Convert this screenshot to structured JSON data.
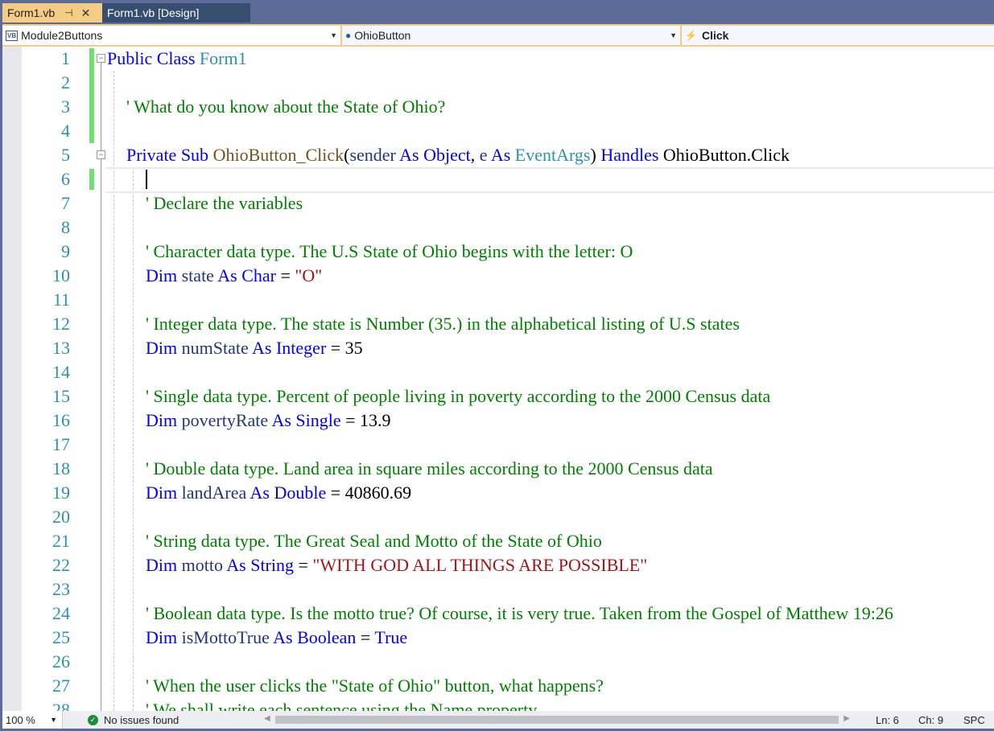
{
  "tabs": [
    {
      "label": "Form1.vb",
      "active": true,
      "pin": "⊣",
      "close": "✕"
    },
    {
      "label": "Form1.vb [Design]",
      "active": false
    }
  ],
  "nav": {
    "project": "Module2Buttons",
    "project_icon": "VB",
    "object": "OhioButton",
    "event": "Click",
    "event_icon": "⚡"
  },
  "lines": [
    {
      "n": "1",
      "tokens": [
        [
          "kw",
          "Public Class "
        ],
        [
          "ty",
          "Form1"
        ]
      ]
    },
    {
      "n": "2",
      "tokens": []
    },
    {
      "n": "3",
      "tokens": [
        [
          "cm",
          "' What do you know about the State of Ohio?"
        ]
      ]
    },
    {
      "n": "4",
      "tokens": []
    },
    {
      "n": "5",
      "tokens": [
        [
          "kw",
          "Private Sub "
        ],
        [
          "mt",
          "OhioButton_Click"
        ],
        [
          "pl",
          "("
        ],
        [
          "id",
          "sender"
        ],
        [
          "kw",
          " As Object"
        ],
        [
          "pl",
          ", "
        ],
        [
          "id",
          "e"
        ],
        [
          "kw",
          " As "
        ],
        [
          "ty",
          "EventArgs"
        ],
        [
          "pl",
          ") "
        ],
        [
          "kw",
          "Handles "
        ],
        [
          "pl",
          "OhioButton.Click"
        ]
      ]
    },
    {
      "n": "6",
      "tokens": []
    },
    {
      "n": "7",
      "tokens": [
        [
          "cm",
          "' Declare the variables"
        ]
      ]
    },
    {
      "n": "8",
      "tokens": []
    },
    {
      "n": "9",
      "tokens": [
        [
          "cm",
          "' Character data type. The U.S State of Ohio begins with the letter: O"
        ]
      ]
    },
    {
      "n": "10",
      "tokens": [
        [
          "kw",
          "Dim "
        ],
        [
          "id",
          "state"
        ],
        [
          "kw",
          " As Char"
        ],
        [
          "pl",
          " = "
        ],
        [
          "st",
          "\"O\""
        ]
      ]
    },
    {
      "n": "11",
      "tokens": []
    },
    {
      "n": "12",
      "tokens": [
        [
          "cm",
          "' Integer data type. The state is Number (35.) in the alphabetical listing of U.S states"
        ]
      ]
    },
    {
      "n": "13",
      "tokens": [
        [
          "kw",
          "Dim "
        ],
        [
          "id",
          "numState"
        ],
        [
          "kw",
          " As Integer"
        ],
        [
          "pl",
          " = 35"
        ]
      ]
    },
    {
      "n": "14",
      "tokens": []
    },
    {
      "n": "15",
      "tokens": [
        [
          "cm",
          "' Single data type. Percent of people living in poverty according to the 2000 Census data"
        ]
      ]
    },
    {
      "n": "16",
      "tokens": [
        [
          "kw",
          "Dim "
        ],
        [
          "id",
          "povertyRate"
        ],
        [
          "kw",
          " As Single"
        ],
        [
          "pl",
          " = 13.9"
        ]
      ]
    },
    {
      "n": "17",
      "tokens": []
    },
    {
      "n": "18",
      "tokens": [
        [
          "cm",
          "' Double data type. Land area in square miles according to the 2000 Census data"
        ]
      ]
    },
    {
      "n": "19",
      "tokens": [
        [
          "kw",
          "Dim "
        ],
        [
          "id",
          "landArea"
        ],
        [
          "kw",
          " As Double"
        ],
        [
          "pl",
          " = 40860.69"
        ]
      ]
    },
    {
      "n": "20",
      "tokens": []
    },
    {
      "n": "21",
      "tokens": [
        [
          "cm",
          "' String data type. The Great Seal and Motto of the State of Ohio"
        ]
      ]
    },
    {
      "n": "22",
      "tokens": [
        [
          "kw",
          "Dim "
        ],
        [
          "id",
          "motto"
        ],
        [
          "kw",
          " As String"
        ],
        [
          "pl",
          " = "
        ],
        [
          "st",
          "\"WITH GOD ALL THINGS ARE POSSIBLE\""
        ]
      ]
    },
    {
      "n": "23",
      "tokens": []
    },
    {
      "n": "24",
      "tokens": [
        [
          "cm",
          "' Boolean data type. Is the motto true? Of course, it is very true. Taken from the Gospel of Matthew 19:26"
        ]
      ]
    },
    {
      "n": "25",
      "tokens": [
        [
          "kw",
          "Dim "
        ],
        [
          "id",
          "isMottoTrue"
        ],
        [
          "kw",
          " As Boolean"
        ],
        [
          "pl",
          " = "
        ],
        [
          "kw",
          "True"
        ]
      ]
    },
    {
      "n": "26",
      "tokens": []
    },
    {
      "n": "27",
      "tokens": [
        [
          "cm",
          "' When the user clicks the \"State of Ohio\" button, what happens?"
        ]
      ]
    },
    {
      "n": "28",
      "tokens": [
        [
          "cm",
          "' We shall write each sentence using the Name property"
        ]
      ]
    }
  ],
  "status": {
    "zoom": "100 %",
    "issues": "No issues found",
    "ln": "Ln: 6",
    "ch": "Ch: 9",
    "mode": "SPC"
  }
}
